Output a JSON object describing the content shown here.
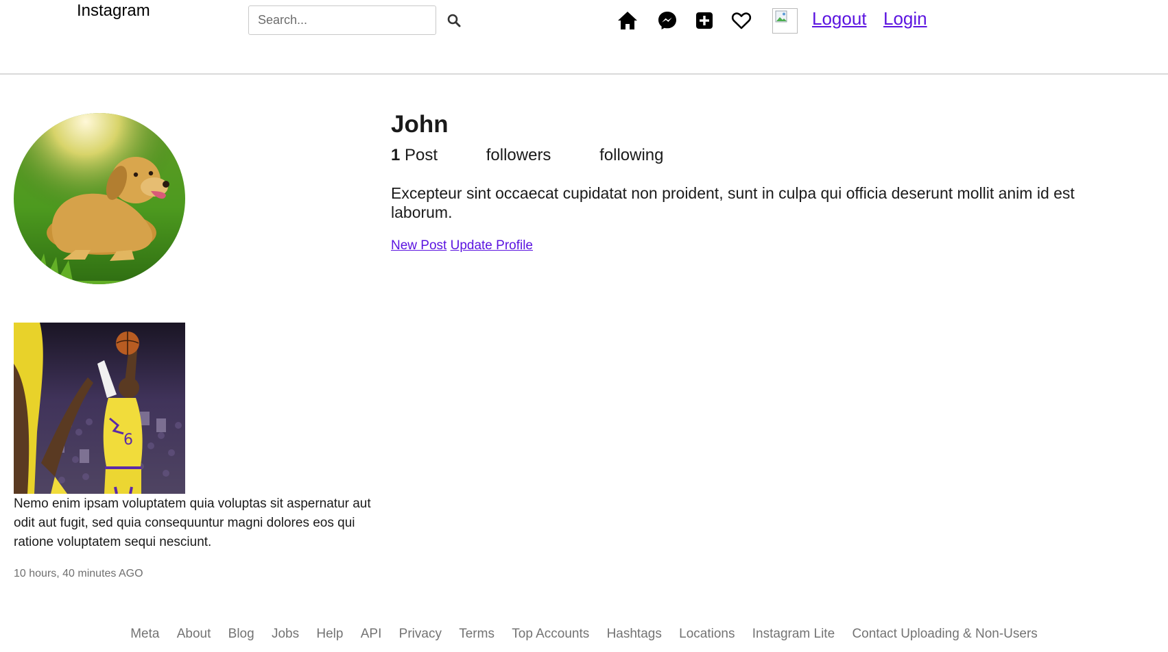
{
  "header": {
    "brand": "Instagram",
    "search_placeholder": "Search...",
    "icons": [
      "search-icon",
      "home-icon",
      "messenger-icon",
      "new-post-icon",
      "heart-icon"
    ],
    "logout_label": "Logout",
    "login_label": "Login"
  },
  "profile": {
    "username": "John",
    "posts_count": "1",
    "posts_label": "Post",
    "followers_label": "followers",
    "following_label": "following",
    "bio": "Excepteur sint occaecat cupidatat non proident, sunt in culpa qui officia deserunt mollit anim id est laborum.",
    "new_post_label": "New Post",
    "update_profile_label": "Update Profile"
  },
  "posts": [
    {
      "caption": "Nemo enim ipsam voluptatem quia voluptas sit aspernatur aut odit aut fugit, sed quia consequuntur magni dolores eos qui ratione voluptatem sequi nesciunt.",
      "time": "10 hours, 40 minutes AGO"
    }
  ],
  "footer": {
    "links": [
      "Meta",
      "About",
      "Blog",
      "Jobs",
      "Help",
      "API",
      "Privacy",
      "Terms",
      "Top Accounts",
      "Hashtags",
      "Locations",
      "Instagram Lite",
      "Contact Uploading & Non-Users"
    ]
  },
  "colors": {
    "link": "#5b14e0",
    "footer_text": "#737373",
    "divider": "#d9d9d9"
  }
}
